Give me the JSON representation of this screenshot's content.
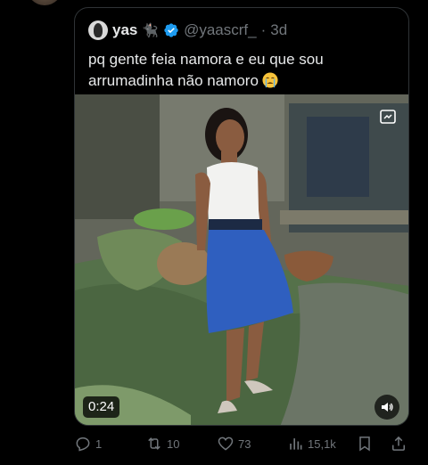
{
  "quoted_tweet": {
    "display_name": "yas",
    "name_emoji": "🐈‍⬛",
    "handle": "@yaascrf_",
    "separator": "·",
    "time": "3d",
    "text_line_1": "pq gente feia namora e eu que sou",
    "text_line_2": "arrumadinha não namoro",
    "text_emoji": "crying-face",
    "media": {
      "duration": "0:24",
      "sound_icon": "speaker-icon"
    }
  },
  "actions": {
    "replies": "1",
    "retweets": "10",
    "likes": "73",
    "views": "15,1k"
  },
  "colors": {
    "background": "#000000",
    "text": "#e7e9ea",
    "secondary": "#71767b",
    "verified": "#1d9bf0",
    "border": "#2f3336"
  }
}
